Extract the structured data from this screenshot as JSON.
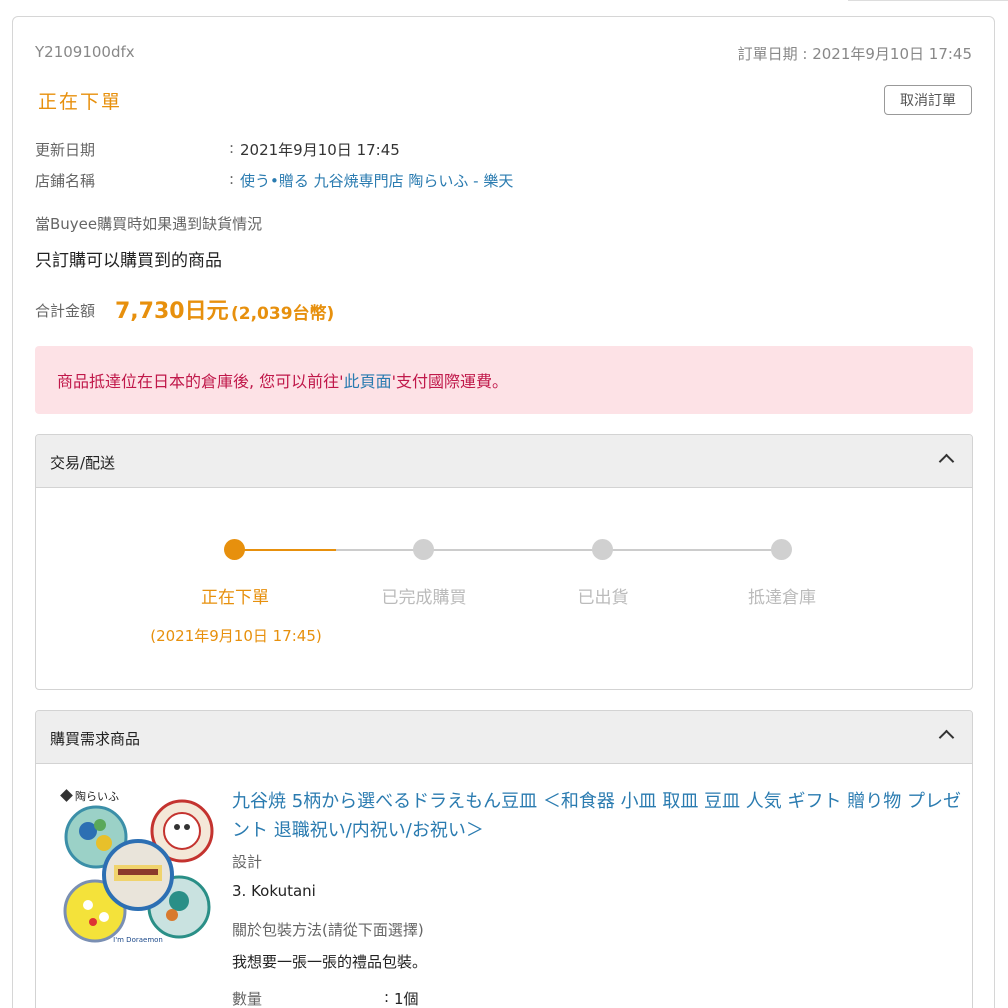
{
  "order": {
    "id": "Y2109100dfx",
    "date_text": "訂單日期 : 2021年9月10日 17:45",
    "status": "正在下單",
    "cancel_label": "取消訂單"
  },
  "info": {
    "update_label": "更新日期",
    "update_value": "2021年9月10日 17:45",
    "shop_label": "店鋪名稱",
    "shop_value": "使う•贈る 九谷焼専門店 陶らいふ - 樂天",
    "colon": ":"
  },
  "shortage": {
    "label": "當Buyee購買時如果遇到缺貨情況",
    "value": "只訂購可以購買到的商品"
  },
  "total": {
    "label": "合計金額",
    "amount": "7,730日元",
    "twd": "(2,039台幣)"
  },
  "alert": {
    "text_before": "商品抵達位在日本的倉庫後, 您可以前往'",
    "link": "此頁面",
    "text_after": "'支付國際運費。"
  },
  "trade_panel": {
    "title": "交易/配送",
    "steps": [
      "正在下單",
      "已完成購買",
      "已出貨",
      "抵達倉庫"
    ],
    "active_step": 0,
    "active_date": "(2021年9月10日 17:45)"
  },
  "items_panel": {
    "title": "購買需求商品",
    "product": {
      "title": "九谷焼 5柄から選べるドラえもん豆皿 ＜和食器 小皿 取皿 豆皿 人気 ギフト 贈り物 プレゼント 退職祝い/内祝い/お祝い＞",
      "design_label": "設計",
      "design_value": "3. Kokutani",
      "wrap_label": "關於包裝方法(請從下面選擇)",
      "wrap_value": "我想要一張一張的禮品包裝。",
      "qty_label": "數量",
      "qty_value": "1個",
      "image_brand": "陶らいふ",
      "image_caption": "I'm Doraemon"
    }
  },
  "colors": {
    "accent": "#e7900d",
    "link": "#2a7bb0",
    "alert_bg": "#fde2e6",
    "alert_text": "#c0184a"
  }
}
